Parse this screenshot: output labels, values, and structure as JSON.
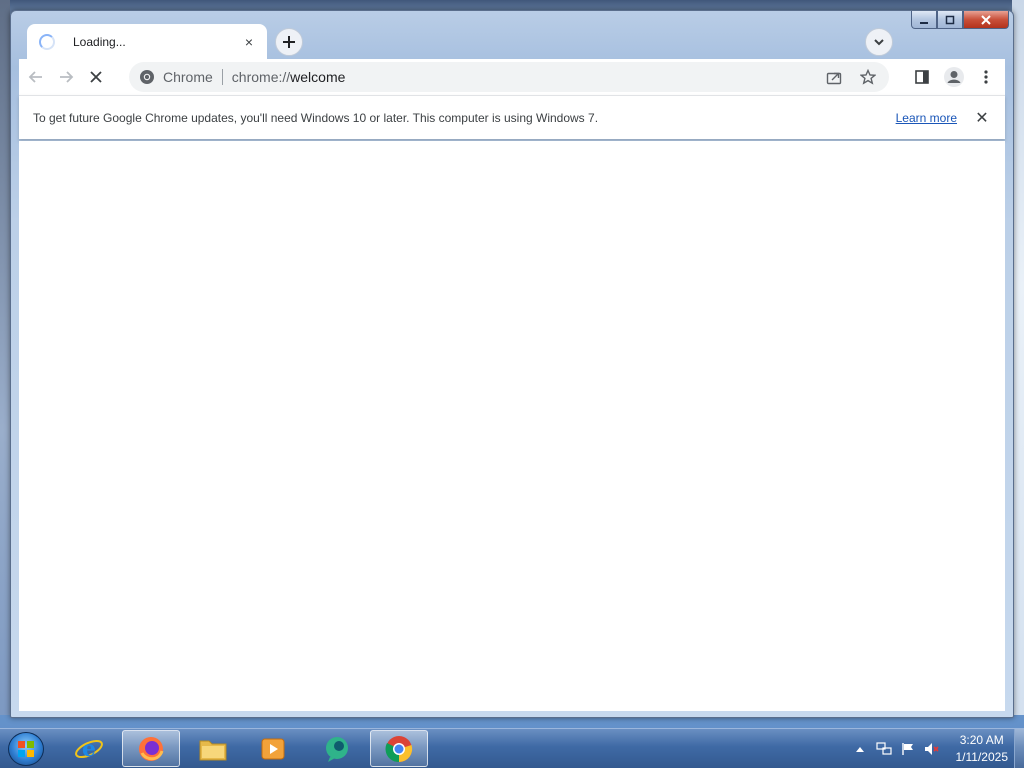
{
  "tab": {
    "title": "Loading...",
    "close_symbol": "×"
  },
  "toolbar": {
    "back_icon": "arrow-left-icon",
    "forward_icon": "arrow-right-icon",
    "stop_icon": "close-icon"
  },
  "omnibox": {
    "site_label": "Chrome",
    "url_scheme": "chrome://",
    "url_path": "welcome"
  },
  "infobar": {
    "message": "To get future Google Chrome updates, you'll need Windows 10 or later. This computer is using Windows 7.",
    "link_label": "Learn more",
    "close_symbol": "✕"
  },
  "taskbar": {
    "apps": [
      "Internet Explorer",
      "Firefox",
      "Windows Explorer",
      "Media Player",
      "Windows Live Messenger",
      "Google Chrome"
    ],
    "clock": {
      "time": "3:20 AM",
      "date": "1/11/2025"
    }
  },
  "colors": {
    "accent_blue": "#1a73e8",
    "link": "#1a56b8",
    "taskbar": "#3f6aa5"
  }
}
